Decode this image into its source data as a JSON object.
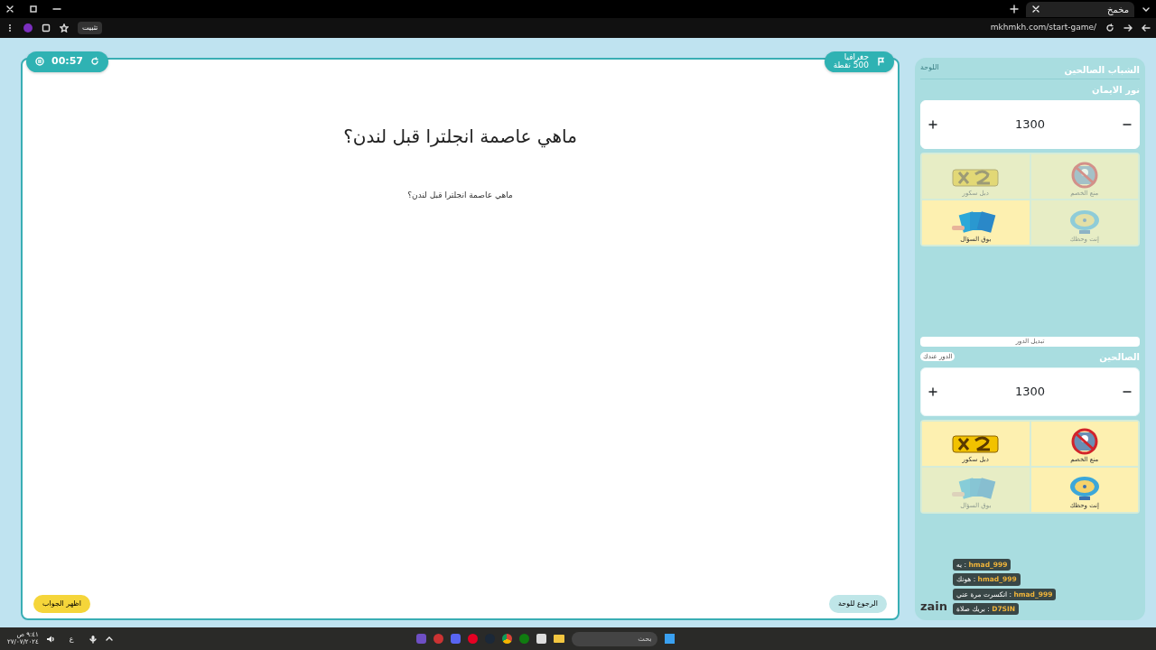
{
  "browser": {
    "tab_title": "مخمخ",
    "url": "mkhmkh.com/start-game/",
    "pin_label": "تثبيت"
  },
  "game": {
    "category": "جغرافيا",
    "points": "500 نقطة",
    "timer": "00:57",
    "question": "ماهي عاصمة انجلترا قبل لندن؟",
    "image_alt": "ماهي عاصمة انجلترا قبل لندن؟",
    "back_button": "الرجوع للوحة",
    "answer_button": "اظهر الجواب"
  },
  "panel": {
    "title": "الشباب الصالحين",
    "board_button": "اللوحة",
    "switch_turn": "تبديل الدور"
  },
  "teams": [
    {
      "name": "نور الايمان",
      "score": "1300",
      "turn": false,
      "helpers": [
        {
          "kind": "block",
          "label": "منع الخصم",
          "used": true
        },
        {
          "kind": "double",
          "label": "دبل سكور",
          "used": true
        },
        {
          "kind": "wheel",
          "label": "إنت وحظك",
          "used": true
        },
        {
          "kind": "cards",
          "label": "بوق السؤال",
          "used": false
        }
      ]
    },
    {
      "name": "الصالحين",
      "score": "1300",
      "turn": true,
      "turn_label": "الدور عندك",
      "helpers": [
        {
          "kind": "block",
          "label": "منع الخصم",
          "used": false
        },
        {
          "kind": "double",
          "label": "دبل سكور",
          "used": false
        },
        {
          "kind": "wheel",
          "label": "إنت وحظك",
          "used": false
        },
        {
          "kind": "cards",
          "label": "بوق السؤال",
          "used": true
        }
      ]
    }
  ],
  "chat": [
    {
      "user": "hmad_999",
      "text": ": يه"
    },
    {
      "user": "hmad_999",
      "text": ": هونك"
    },
    {
      "user": "hmad_999",
      "text": ": انكسرت مرة عني"
    },
    {
      "user": "D7SIN",
      "text": ": بريك صلاة"
    }
  ],
  "overlay_logo": "zain",
  "taskbar": {
    "search_placeholder": "بحث",
    "language": "ع",
    "time": "٩:٤١ ص",
    "date": "٢٧/٠٧/٢٠٢٤"
  }
}
